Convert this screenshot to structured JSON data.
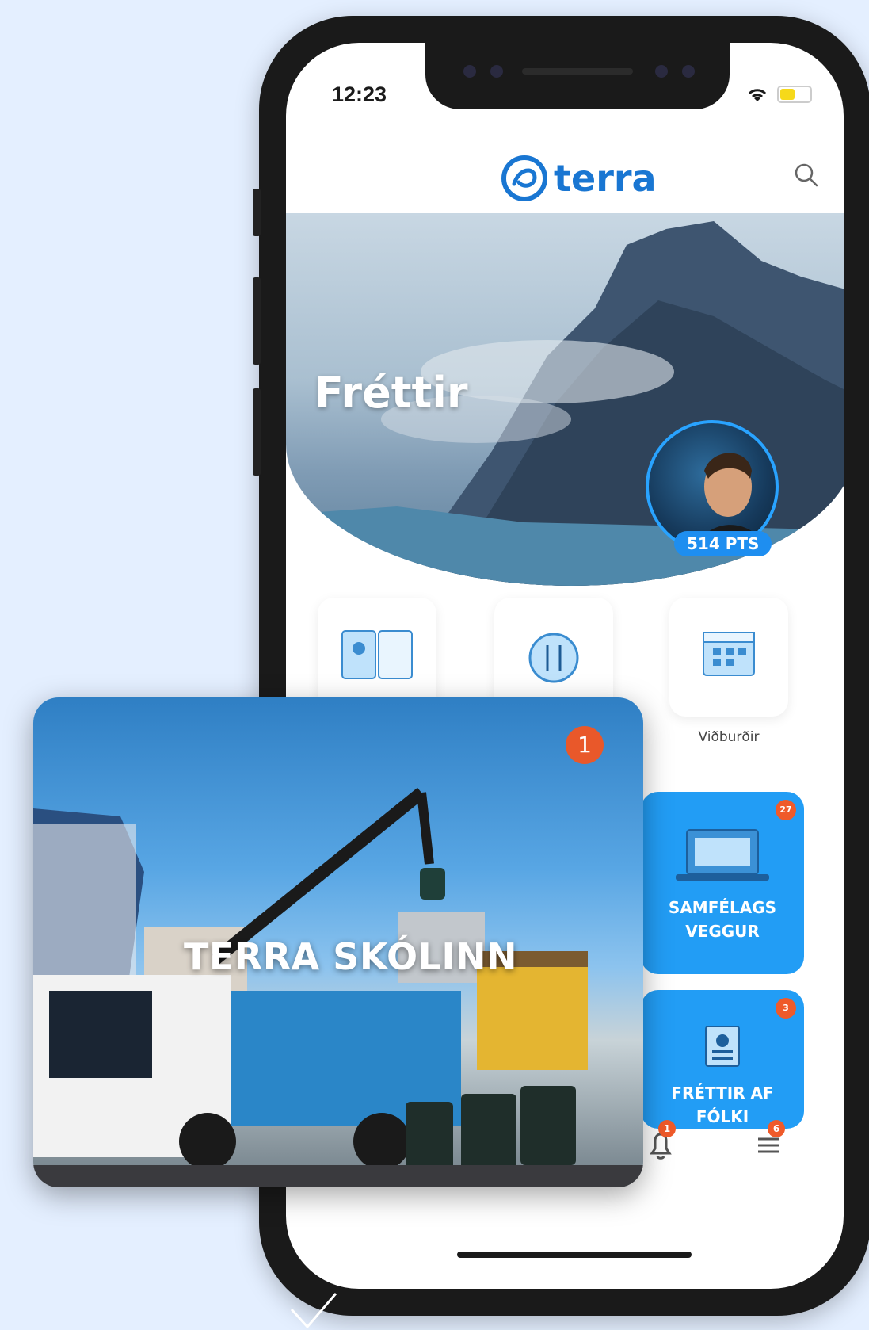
{
  "status_bar": {
    "time": "12:23"
  },
  "header": {
    "logo_text": "terra"
  },
  "hero": {
    "title": "Fréttir"
  },
  "profile": {
    "points": "514 PTS"
  },
  "categories": [
    {
      "label": ""
    },
    {
      "label": ""
    },
    {
      "label": "Viðburðir"
    }
  ],
  "tiles": {
    "community": {
      "line1": "SAMFÉLAGS",
      "line2": "VEGGUR",
      "count": "27"
    },
    "people": {
      "line1": "FRÉTTIR AF",
      "line2": "FÓLKI",
      "count": "3"
    }
  },
  "tab_bar": {
    "notifications_count": "1",
    "menu_count": "6"
  },
  "overlay": {
    "title": "TERRA SKÓLINN",
    "badge": "1"
  },
  "colors": {
    "brand": "#1976d2",
    "tile_blue": "#229df5",
    "badge_orange": "#ef5a2a",
    "background": "#e4efff"
  }
}
